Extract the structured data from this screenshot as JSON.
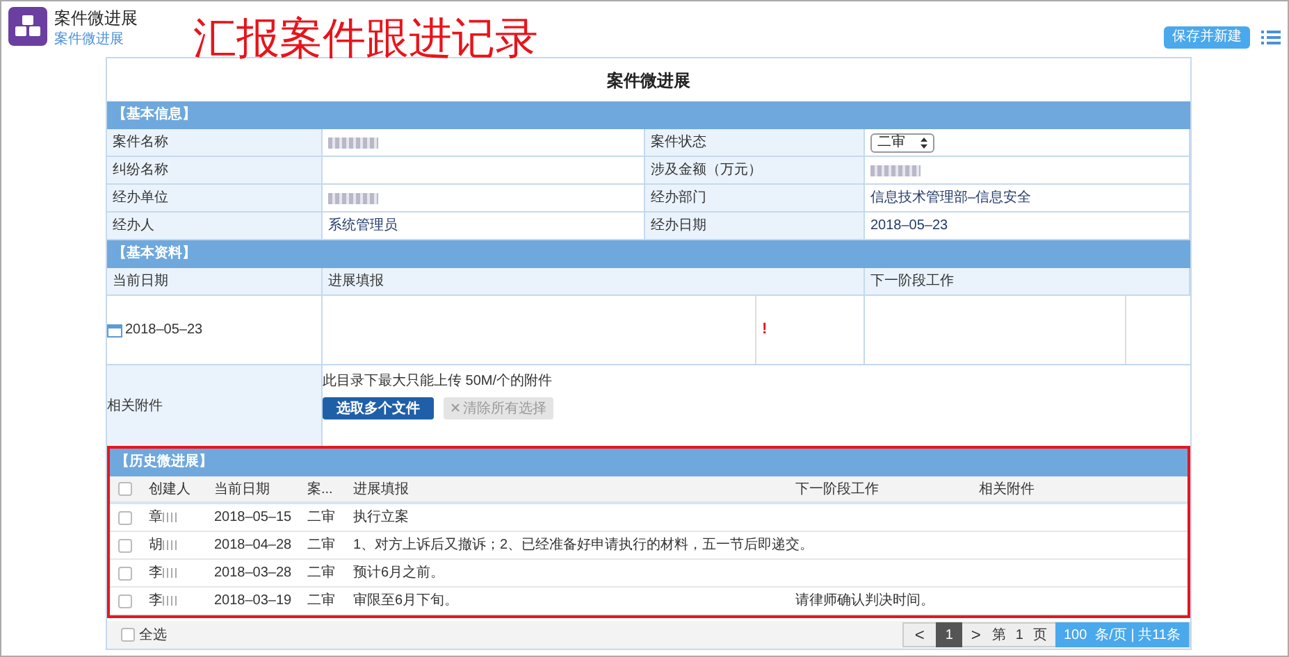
{
  "app": {
    "title": "案件微进展",
    "tab": "案件微进展",
    "save_button": "保存并新建"
  },
  "annotation": "汇报案件跟进记录",
  "form": {
    "title": "案件微进展",
    "basic_info": {
      "header": "【基本信息】",
      "fields": [
        {
          "label": "案件名称",
          "redacted": true
        },
        {
          "label": "案件状态",
          "kind": "select",
          "value": "二审"
        },
        {
          "label": "纠纷名称"
        },
        {
          "label": "涉及金额（万元）",
          "redacted": true
        },
        {
          "label": "经办单位",
          "redacted": true
        },
        {
          "label": "经办部门",
          "value": "信息技术管理部–信息安全"
        },
        {
          "label": "经办人",
          "value": "系统管理员"
        },
        {
          "label": "经办日期",
          "value": "2018–05–23"
        }
      ]
    },
    "basic_material": {
      "header": "【基本资料】",
      "columns": [
        "当前日期",
        "进展填报",
        "下一阶段工作"
      ],
      "date": "2018–05–23",
      "required_mark": "!",
      "attachment_label": "相关附件",
      "attachment_hint": "此目录下最大只能上传 50M/个的附件",
      "choose_button": "选取多个文件",
      "clear_button": {
        "label": "清除所有选择",
        "disabled": true
      }
    }
  },
  "history": {
    "header": "【历史微进展】",
    "columns": [
      "创建人",
      "当前日期",
      "案...",
      "进展填报",
      "下一阶段工作",
      "相关附件"
    ],
    "rows": [
      {
        "checked": false,
        "creator": "章",
        "date": "2018–05–15",
        "status": "二审",
        "progress": "执行立案"
      },
      {
        "checked": false,
        "creator": "胡",
        "date": "2018–04–28",
        "status": "二审",
        "progress": "1、对方上诉后又撤诉；2、已经准备好申请执行的材料，五一节后即递交。"
      },
      {
        "checked": false,
        "creator": "李",
        "date": "2018–03–28",
        "status": "二审",
        "progress": "预计6月之前。"
      },
      {
        "checked": false,
        "creator": "李",
        "date": "2018–03–19",
        "status": "二审",
        "progress": "审限至6月下旬。",
        "next": "请律师确认判决时间。"
      }
    ],
    "header_checked": false,
    "select_all": {
      "label": "全选",
      "checked": false
    },
    "pagination": {
      "prev": "<",
      "pages": [
        {
          "label": "1",
          "selected": true
        }
      ],
      "next": ">",
      "page_prefix": "第",
      "current": "1",
      "page_suffix": "页",
      "page_size": "100",
      "summary": "条/页 | 共11条"
    }
  }
}
